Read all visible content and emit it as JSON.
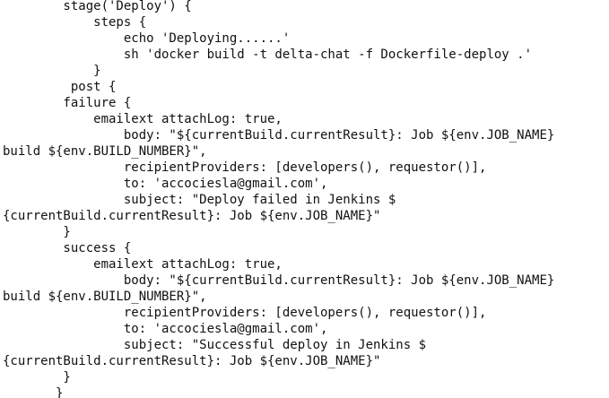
{
  "editor": {
    "lines": [
      "        stage('Deploy') {",
      "            steps {",
      "                echo 'Deploying......'",
      "                sh 'docker build -t delta-chat -f Dockerfile-deploy .'",
      "            }",
      "         post {",
      "        failure {",
      "            emailext attachLog: true,",
      "                body: \"${currentBuild.currentResult}: Job ${env.JOB_NAME}",
      "build ${env.BUILD_NUMBER}\",",
      "                recipientProviders: [developers(), requestor()],",
      "                to: 'accociesla@gmail.com',",
      "                subject: \"Deploy failed in Jenkins $",
      "{currentBuild.currentResult}: Job ${env.JOB_NAME}\"",
      "        }",
      "        success {",
      "            emailext attachLog: true,",
      "                body: \"${currentBuild.currentResult}: Job ${env.JOB_NAME}",
      "build ${env.BUILD_NUMBER}\",",
      "                recipientProviders: [developers(), requestor()],",
      "                to: 'accociesla@gmail.com',",
      "                subject: \"Successful deploy in Jenkins $",
      "{currentBuild.currentResult}: Job ${env.JOB_NAME}\"",
      "        }",
      "       }"
    ]
  }
}
